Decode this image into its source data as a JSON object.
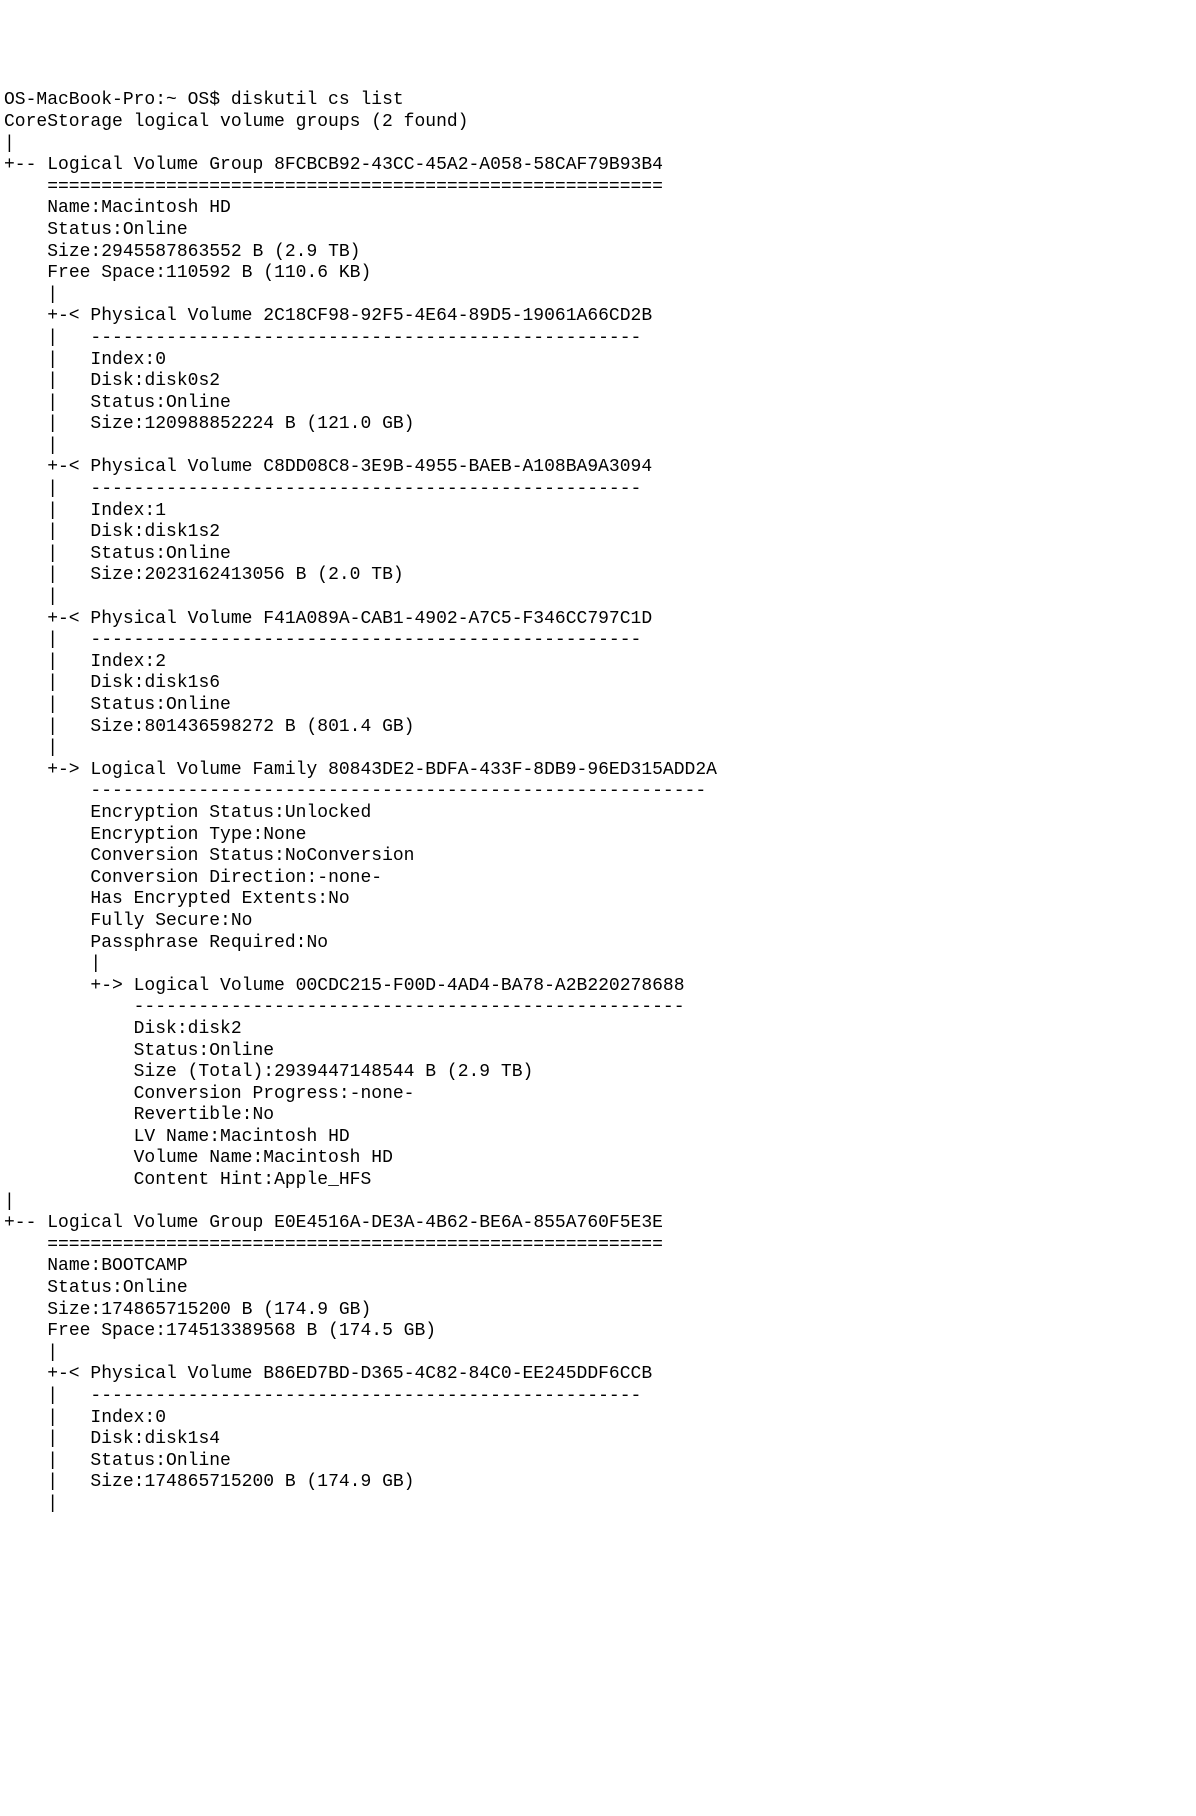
{
  "prompt": "OS-MacBook-Pro:~ OS$ ",
  "command": "diskutil cs list",
  "header": "CoreStorage logical volume groups (2 found)",
  "groups": [
    {
      "uuid": "8FCBCB92-43CC-45A2-A058-58CAF79B93B4",
      "name": "Macintosh HD",
      "status": "Online",
      "size": "2945587863552 B (2.9 TB)",
      "free_space": "110592 B (110.6 KB)",
      "physical_volumes": [
        {
          "uuid": "2C18CF98-92F5-4E64-89D5-19061A66CD2B",
          "index": "0",
          "disk": "disk0s2",
          "status": "Online",
          "size": "120988852224 B (121.0 GB)"
        },
        {
          "uuid": "C8DD08C8-3E9B-4955-BAEB-A108BA9A3094",
          "index": "1",
          "disk": "disk1s2",
          "status": "Online",
          "size": "2023162413056 B (2.0 TB)"
        },
        {
          "uuid": "F41A089A-CAB1-4902-A7C5-F346CC797C1D",
          "index": "2",
          "disk": "disk1s6",
          "status": "Online",
          "size": "801436598272 B (801.4 GB)"
        }
      ],
      "families": [
        {
          "uuid": "80843DE2-BDFA-433F-8DB9-96ED315ADD2A",
          "encryption_status": "Unlocked",
          "encryption_type": "None",
          "conversion_status": "NoConversion",
          "conversion_direction": "-none-",
          "has_encrypted_extents": "No",
          "fully_secure": "No",
          "passphrase_required": "No",
          "logical_volumes": [
            {
              "uuid": "00CDC215-F00D-4AD4-BA78-A2B220278688",
              "disk": "disk2",
              "status": "Online",
              "size_total": "2939447148544 B (2.9 TB)",
              "conversion_progress": "-none-",
              "revertible": "No",
              "lv_name": "Macintosh HD",
              "volume_name": "Macintosh HD",
              "content_hint": "Apple_HFS"
            }
          ]
        }
      ]
    },
    {
      "uuid": "E0E4516A-DE3A-4B62-BE6A-855A760F5E3E",
      "name": "BOOTCAMP",
      "status": "Online",
      "size": "174865715200 B (174.9 GB)",
      "free_space": "174513389568 B (174.5 GB)",
      "physical_volumes": [
        {
          "uuid": "B86ED7BD-D365-4C82-84C0-EE245DDF6CCB",
          "index": "0",
          "disk": "disk1s4",
          "status": "Online",
          "size": "174865715200 B (174.9 GB)"
        }
      ],
      "families": []
    }
  ],
  "labels": {
    "lvg_prefix": "Logical Volume Group",
    "pv_prefix": "Physical Volume",
    "lvf_prefix": "Logical Volume Family",
    "lv_prefix": "Logical Volume",
    "name": "Name:",
    "status": "Status:",
    "size": "Size:",
    "free_space": "Free Space:",
    "index": "Index:",
    "disk": "Disk:",
    "enc_status": "Encryption Status:",
    "enc_type": "Encryption Type:",
    "conv_status": "Conversion Status:",
    "conv_dir": "Conversion Direction:",
    "has_enc_ext": "Has Encrypted Extents:",
    "fully_secure": "Fully Secure:",
    "pass_req": "Passphrase Required:",
    "size_total": "Size (Total):",
    "conv_prog": "Conversion Progress:",
    "revertible": "Revertible:",
    "lv_name": "LV Name:",
    "vol_name": "Volume Name:",
    "content_hint": "Content Hint:"
  }
}
